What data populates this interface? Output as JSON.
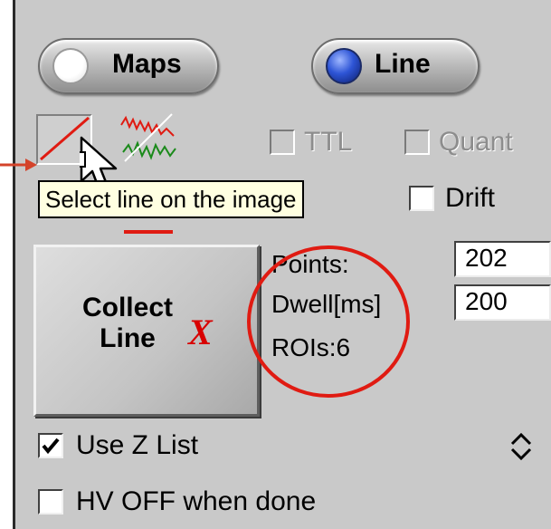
{
  "mode_buttons": [
    {
      "label": "Maps",
      "selected": false
    },
    {
      "label": "Line",
      "selected": true
    }
  ],
  "tools": {
    "select_line_icon": "line-select-icon",
    "multi_line_icon": "multi-line-profile-icon"
  },
  "options_top": {
    "ttl": {
      "label": "TTL",
      "checked": false,
      "enabled": false
    },
    "quant": {
      "label": "Quant",
      "checked": false,
      "enabled": false
    },
    "drift": {
      "label": "Drift",
      "checked": false,
      "enabled": true
    }
  },
  "tooltip": "Select line on the image",
  "collect_button": {
    "line1": "Collect",
    "line2": "Line",
    "mark": "X"
  },
  "params": {
    "points_label": "Points:",
    "points_value": "202",
    "dwell_label": "Dwell[ms]",
    "dwell_value": "200",
    "rois_label": "ROIs:6"
  },
  "options_bottom": {
    "use_z_list": {
      "label": "Use Z List",
      "checked": true
    },
    "hv_off": {
      "label": "HV OFF when done",
      "checked": false
    }
  },
  "colors": {
    "annotation_red": "#e01b12",
    "annotation_arrow": "#d4432a"
  }
}
